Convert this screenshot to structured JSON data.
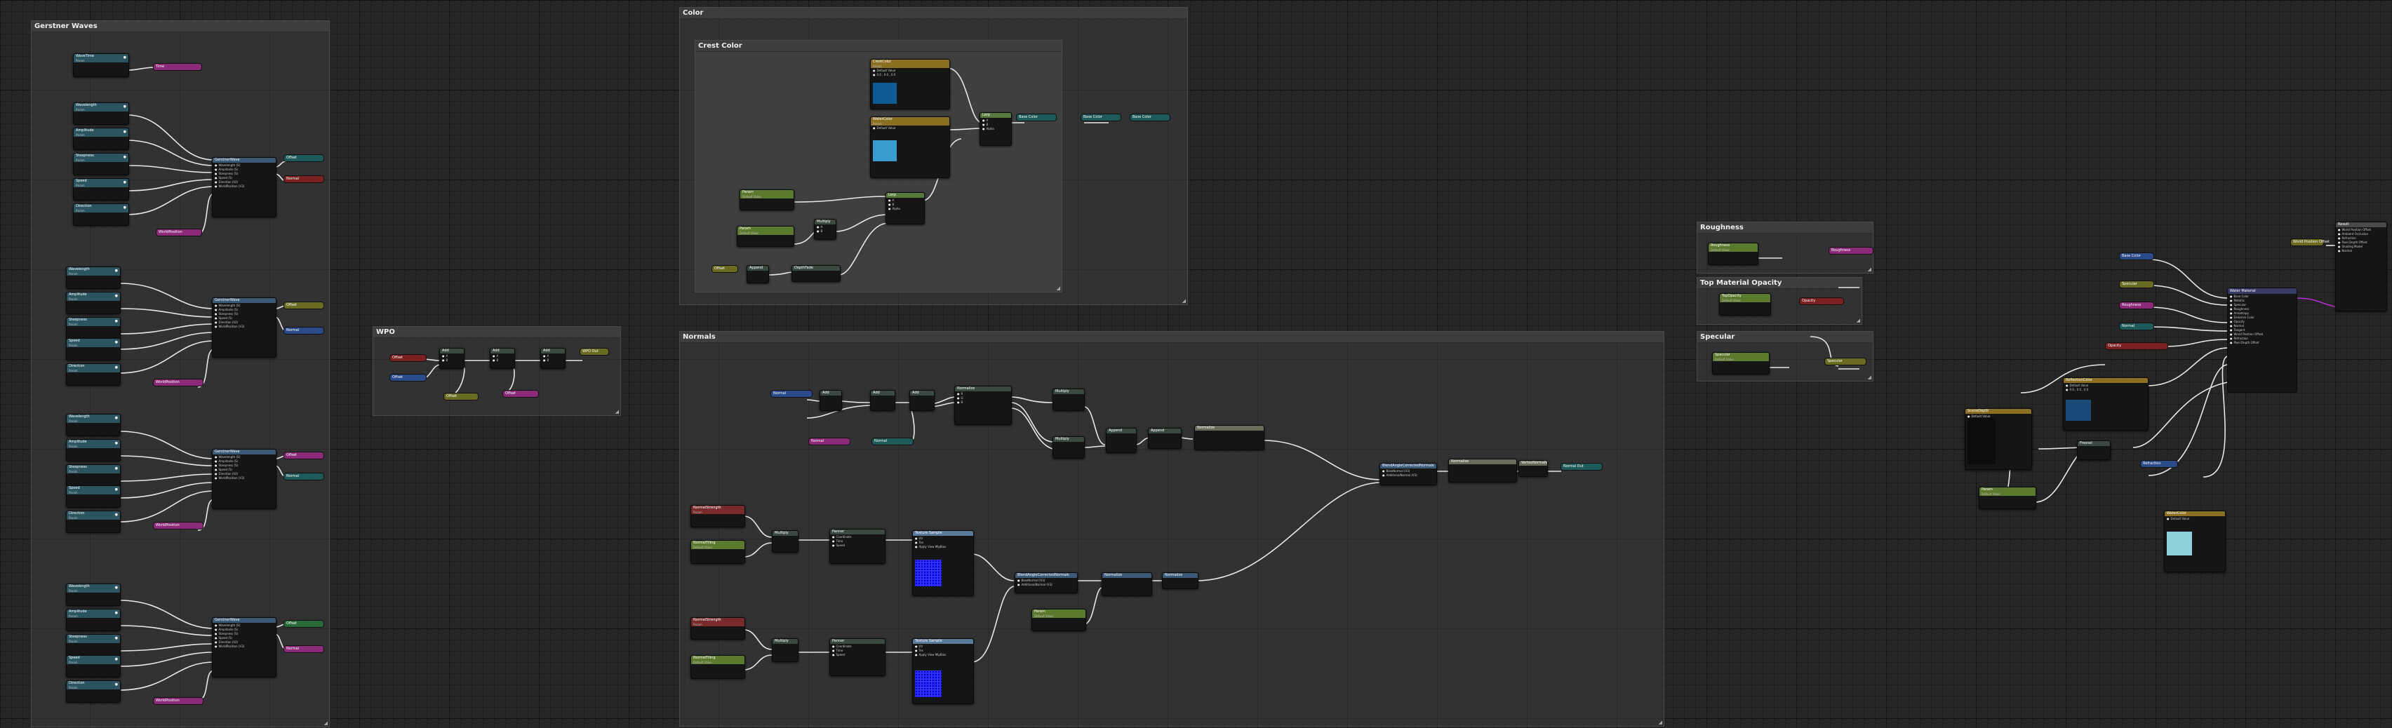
{
  "comments": {
    "gerstner": "Gerstner Waves",
    "crest": "Crest Color",
    "color": "Color",
    "wpo": "WPO",
    "normals": "Normals",
    "roughness": "Roughness",
    "top_opacity": "Top Material Opacity",
    "specular": "Specular"
  },
  "nodes": {
    "wave_time": "WaveTime",
    "wave_func": "GerstnerWave",
    "wavelength": "Wavelength",
    "amplitude": "Amplitude",
    "steepness": "Steepness",
    "speed": "Speed",
    "direction": "Direction",
    "append": "Append",
    "add": "Add",
    "multiply": "Multiply",
    "lerp": "Lerp",
    "crest_color": "CrestColor",
    "water_color": "WaterColor",
    "default_value": "Default Value",
    "param": "Param",
    "world_pos": "WorldPosition",
    "time": "Time",
    "panner": "Panner",
    "texture_sample": "Texture Sample",
    "normal_strength": "NormalStrength",
    "normal_tiling": "NormalTiling",
    "blend_normals": "BlendAngleCorrectedNormals",
    "roughness_p": "Roughness",
    "opacity_p": "TopOpacity",
    "specular_p": "Specular",
    "main_node": "Water Material",
    "fresnel": "Fresnel",
    "depth_fade": "DepthFade",
    "scene_depth": "SceneDepth",
    "normalize": "Normalize",
    "ref_color": "ReflectionColor",
    "vertexnormal": "VertexNormalWS",
    "const3": "Constant3Vector",
    "output_wpo": "WPO Out",
    "output_norm": "Normal Out"
  },
  "pins": {
    "wavelength": "Wavelength (S)",
    "amplitude": "Amplitude (S)",
    "steepness": "Steepness (S)",
    "speed": "Speed (S)",
    "direction": "Direction (V2)",
    "world_pos": "WorldPosition (V3)",
    "a": "A",
    "b": "B",
    "alpha": "Alpha",
    "uv": "UV",
    "tex": "Tex",
    "apply_view_mip": "Apply View MipBias",
    "coordinate": "Coordinate",
    "speed_pin": "Speed",
    "base_normal": "BaseNormal (V3)",
    "additional_normal": "AdditionalNormal (V3)",
    "result": "Result",
    "base_color": "Base Color",
    "metallic": "Metallic",
    "specular": "Specular",
    "roughness": "Roughness",
    "anisotropy": "Anisotropy",
    "emissive": "Emissive Color",
    "opacity": "Opacity",
    "normal": "Normal",
    "tangent": "Tangent",
    "wpo": "World Position Offset",
    "refraction": "Refraction",
    "pixel_depth": "Pixel Depth Offset",
    "shading_model": "Shading Model",
    "ao": "Ambient Occlusion",
    "wave_normal": "Normal",
    "wave_offset": "Offset"
  },
  "values": {
    "zero": "0.0",
    "one": "1.0",
    "half": "0.5",
    "vec_default": "0.0 , 0.0 , 0.0",
    "r": "R",
    "g": "G",
    "b": "B",
    "a": "A",
    "rgba": "RGBA"
  }
}
